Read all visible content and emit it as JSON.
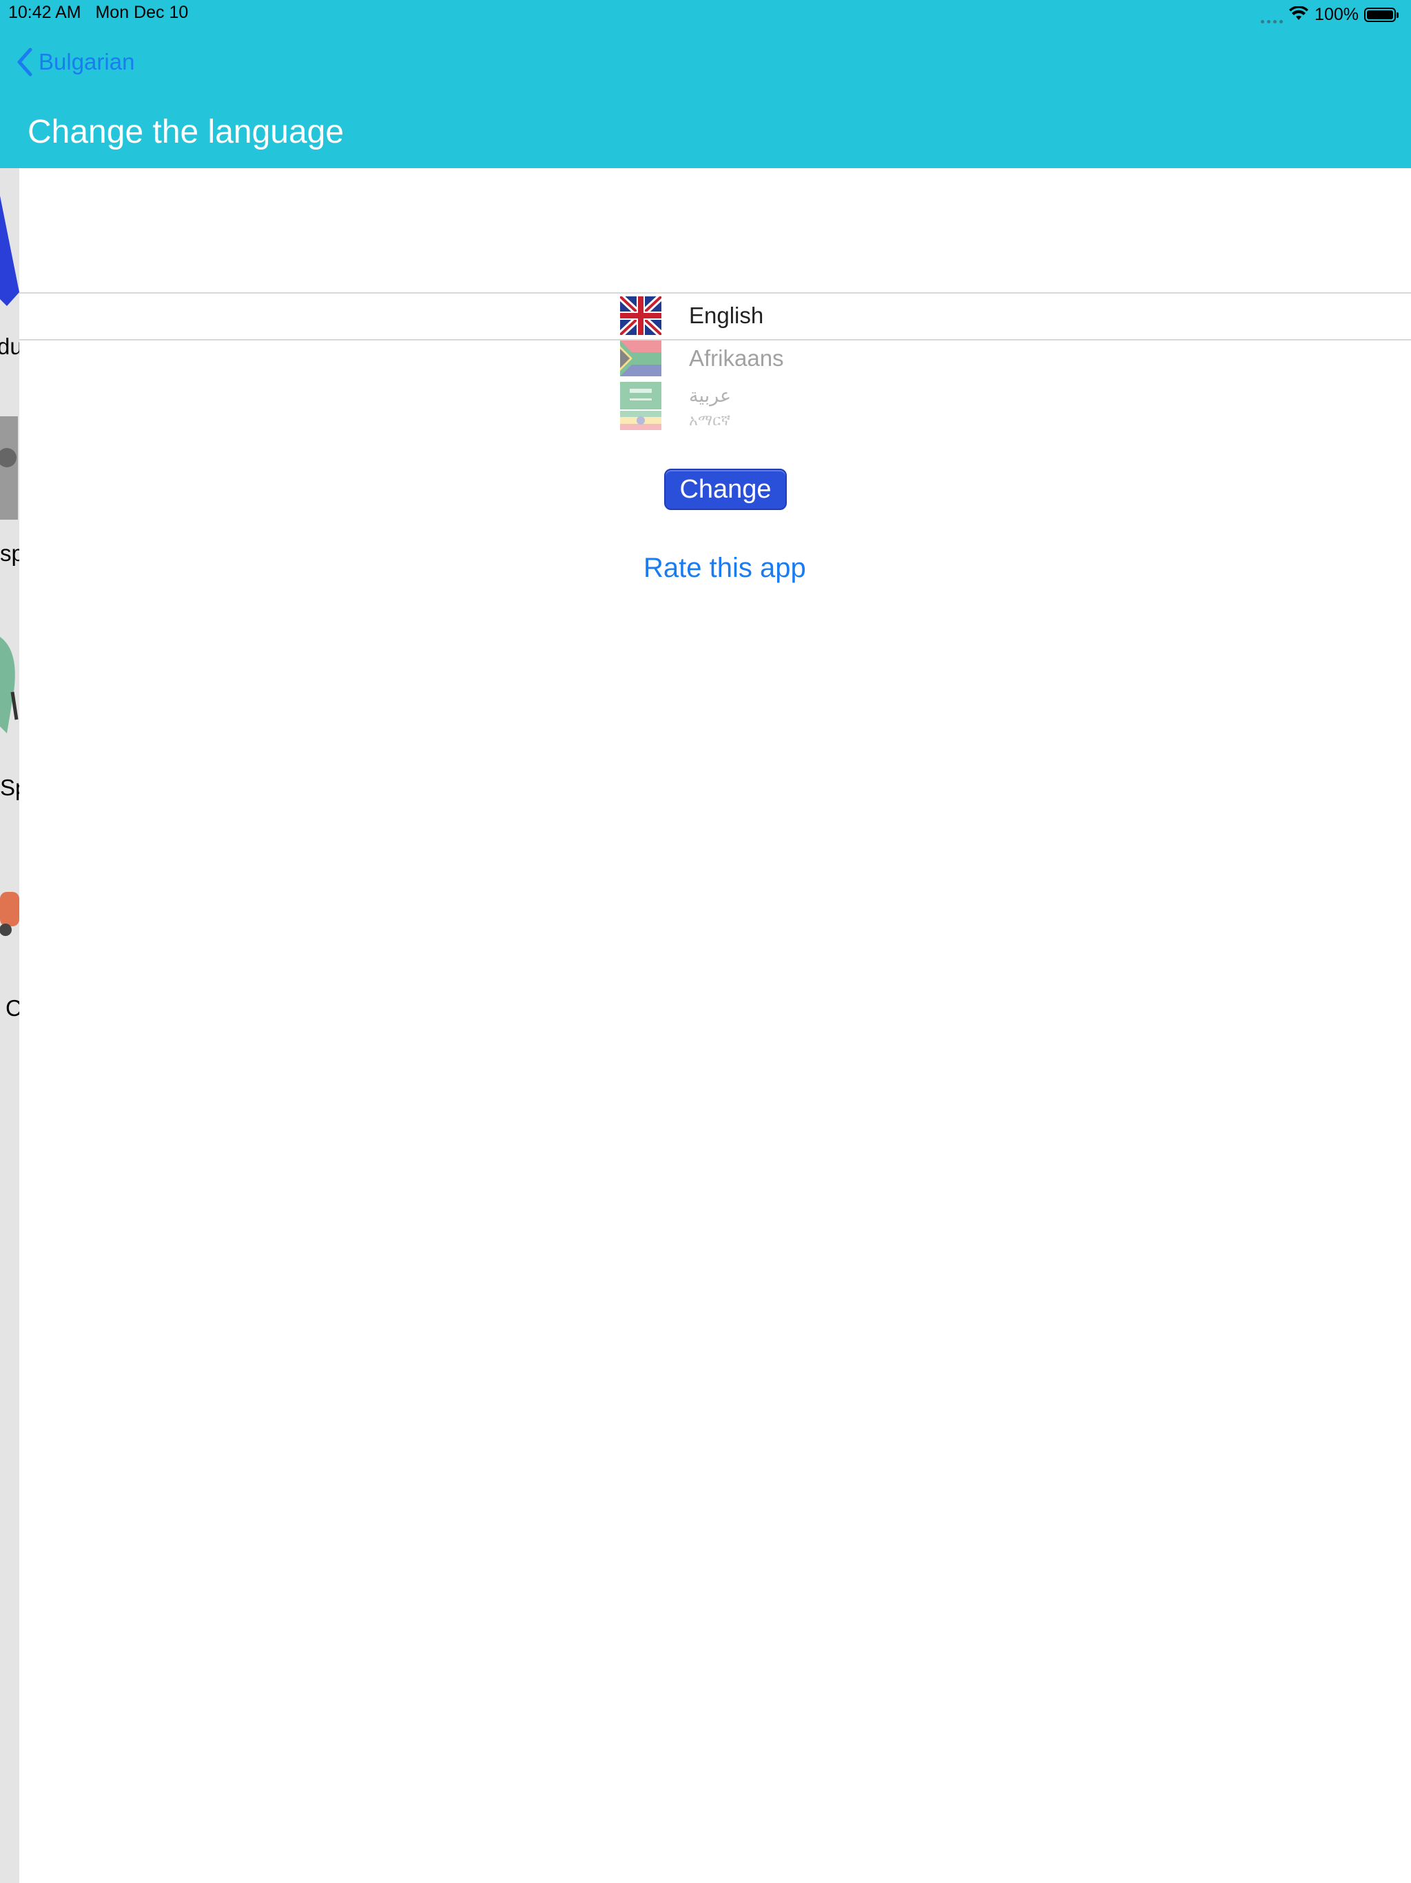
{
  "status_bar": {
    "time": "10:42 AM",
    "date": "Mon Dec 10",
    "battery": "100%"
  },
  "nav": {
    "back_label": "Bulgarian",
    "title": "Change the language"
  },
  "side_panel": {
    "partial_labels": [
      "du",
      "sp",
      "Sp",
      "C"
    ]
  },
  "language_picker": {
    "options": [
      {
        "label": "English",
        "flag": "uk-flag-icon",
        "selected": true
      },
      {
        "label": "Afrikaans",
        "flag": "south-africa-flag-icon"
      },
      {
        "label": "عربية",
        "flag": "saudi-arabia-flag-icon"
      },
      {
        "label": "አማርኛ",
        "flag": "ethiopia-flag-icon"
      }
    ]
  },
  "buttons": {
    "change": "Change",
    "rate": "Rate this app"
  },
  "colors": {
    "header": "#24C4DA",
    "link": "#1b7cf2",
    "button": "#2a4fd9"
  }
}
